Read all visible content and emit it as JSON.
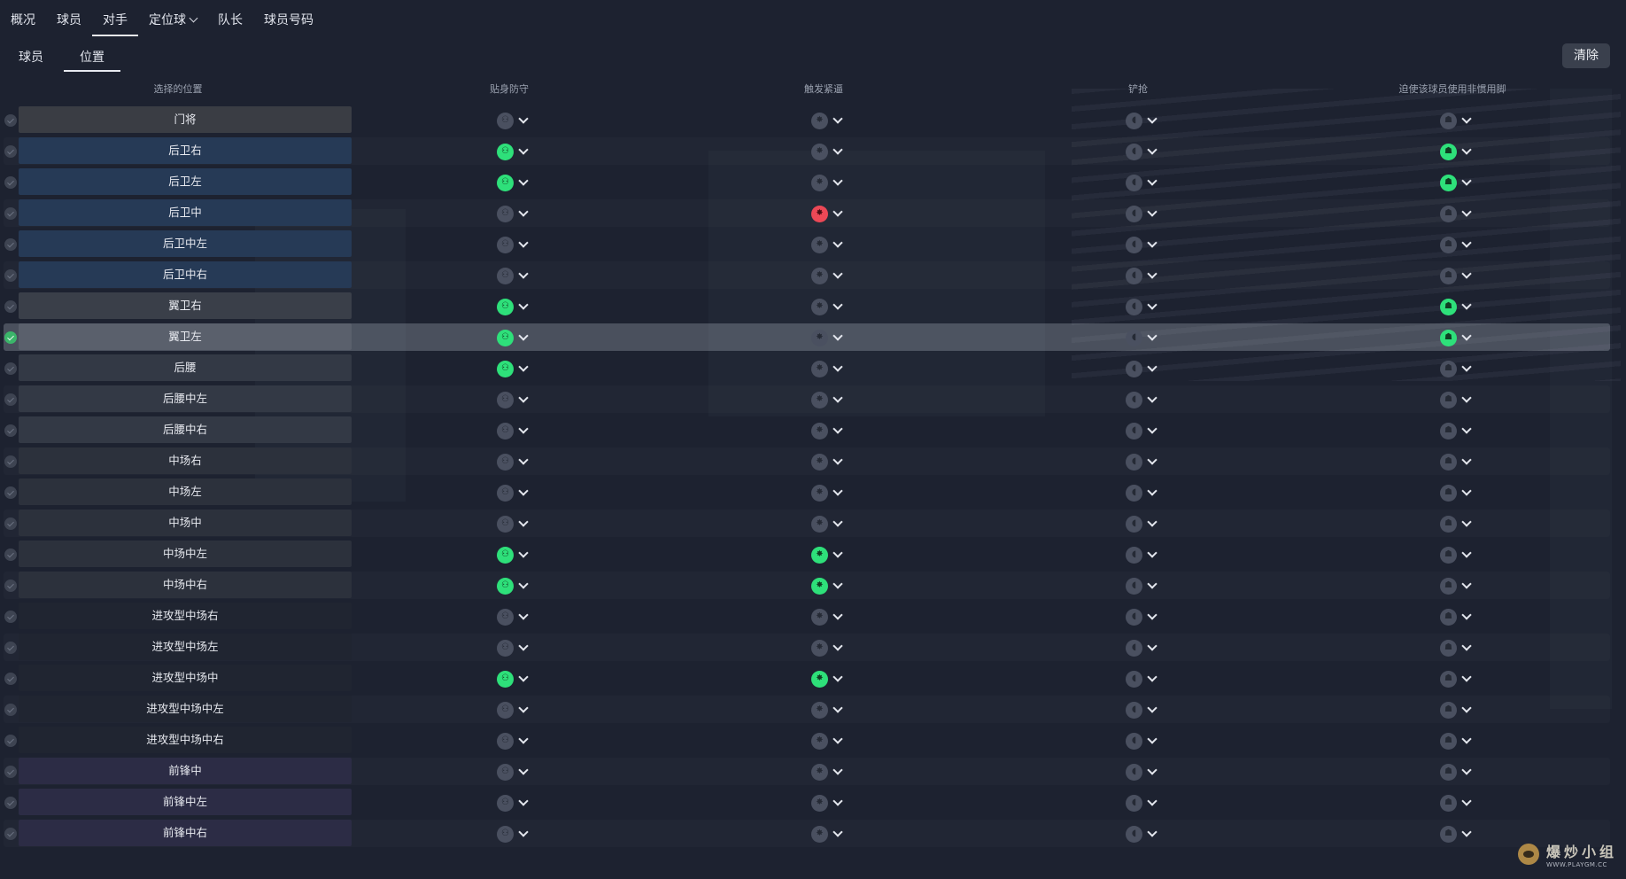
{
  "top_tabs": [
    {
      "label": "概况",
      "active": false
    },
    {
      "label": "球员",
      "active": false
    },
    {
      "label": "对手",
      "active": true
    },
    {
      "label": "定位球",
      "active": false,
      "dropdown": true
    },
    {
      "label": "队长",
      "active": false
    },
    {
      "label": "球员号码",
      "active": false
    }
  ],
  "sub_tabs": [
    {
      "label": "球员",
      "active": false
    },
    {
      "label": "位置",
      "active": true
    }
  ],
  "clear_button": "清除",
  "columns": {
    "position": "选择的位置",
    "tight_marking": "贴身防守",
    "trigger_press": "触发紧逼",
    "tackling": "铲抢",
    "weak_foot": "迫使该球员使用非惯用脚"
  },
  "icon_names": {
    "tight_marking": "tight-marking-icon",
    "trigger_press": "trigger-press-icon",
    "tackling": "tackling-icon",
    "weak_foot": "weak-foot-icon"
  },
  "states_legend": {
    "off": "not set (grey)",
    "on": "enabled (green)",
    "neg": "disabled (red)"
  },
  "colors": {
    "on": "#2ee07a",
    "neg": "#ec4856",
    "off": "#4a5060",
    "selected_check": "#3bb56a"
  },
  "rows": [
    {
      "position": "门将",
      "group": "gk",
      "marking": "off",
      "press": "off",
      "tackle": "off",
      "weakfoot": "off",
      "selected": false
    },
    {
      "position": "后卫右",
      "group": "def",
      "marking": "on",
      "press": "off",
      "tackle": "off",
      "weakfoot": "on",
      "selected": false
    },
    {
      "position": "后卫左",
      "group": "def",
      "marking": "on",
      "press": "off",
      "tackle": "off",
      "weakfoot": "on",
      "selected": false
    },
    {
      "position": "后卫中",
      "group": "def",
      "marking": "off",
      "press": "neg",
      "tackle": "off",
      "weakfoot": "off",
      "selected": false
    },
    {
      "position": "后卫中左",
      "group": "def",
      "marking": "off",
      "press": "off",
      "tackle": "off",
      "weakfoot": "off",
      "selected": false
    },
    {
      "position": "后卫中右",
      "group": "def",
      "marking": "off",
      "press": "off",
      "tackle": "off",
      "weakfoot": "off",
      "selected": false
    },
    {
      "position": "翼卫右",
      "group": "wb",
      "marking": "on",
      "press": "off",
      "tackle": "off",
      "weakfoot": "on",
      "selected": false
    },
    {
      "position": "翼卫左",
      "group": "wb",
      "marking": "on",
      "press": "off",
      "tackle": "off",
      "weakfoot": "on",
      "selected": true
    },
    {
      "position": "后腰",
      "group": "dm",
      "marking": "on",
      "press": "off",
      "tackle": "off",
      "weakfoot": "off",
      "selected": false
    },
    {
      "position": "后腰中左",
      "group": "dm",
      "marking": "off",
      "press": "off",
      "tackle": "off",
      "weakfoot": "off",
      "selected": false
    },
    {
      "position": "后腰中右",
      "group": "dm",
      "marking": "off",
      "press": "off",
      "tackle": "off",
      "weakfoot": "off",
      "selected": false
    },
    {
      "position": "中场右",
      "group": "mid",
      "marking": "off",
      "press": "off",
      "tackle": "off",
      "weakfoot": "off",
      "selected": false
    },
    {
      "position": "中场左",
      "group": "mid",
      "marking": "off",
      "press": "off",
      "tackle": "off",
      "weakfoot": "off",
      "selected": false
    },
    {
      "position": "中场中",
      "group": "mid",
      "marking": "off",
      "press": "off",
      "tackle": "off",
      "weakfoot": "off",
      "selected": false
    },
    {
      "position": "中场中左",
      "group": "mid",
      "marking": "on",
      "press": "on",
      "tackle": "off",
      "weakfoot": "off",
      "selected": false
    },
    {
      "position": "中场中右",
      "group": "mid",
      "marking": "on",
      "press": "on",
      "tackle": "off",
      "weakfoot": "off",
      "selected": false
    },
    {
      "position": "进攻型中场右",
      "group": "am",
      "marking": "off",
      "press": "off",
      "tackle": "off",
      "weakfoot": "off",
      "selected": false
    },
    {
      "position": "进攻型中场左",
      "group": "am",
      "marking": "off",
      "press": "off",
      "tackle": "off",
      "weakfoot": "off",
      "selected": false
    },
    {
      "position": "进攻型中场中",
      "group": "am",
      "marking": "on",
      "press": "on",
      "tackle": "off",
      "weakfoot": "off",
      "selected": false
    },
    {
      "position": "进攻型中场中左",
      "group": "am",
      "marking": "off",
      "press": "off",
      "tackle": "off",
      "weakfoot": "off",
      "selected": false
    },
    {
      "position": "进攻型中场中右",
      "group": "am",
      "marking": "off",
      "press": "off",
      "tackle": "off",
      "weakfoot": "off",
      "selected": false
    },
    {
      "position": "前锋中",
      "group": "st",
      "marking": "off",
      "press": "off",
      "tackle": "off",
      "weakfoot": "off",
      "selected": false
    },
    {
      "position": "前锋中左",
      "group": "st",
      "marking": "off",
      "press": "off",
      "tackle": "off",
      "weakfoot": "off",
      "selected": false
    },
    {
      "position": "前锋中右",
      "group": "st",
      "marking": "off",
      "press": "off",
      "tackle": "off",
      "weakfoot": "off",
      "selected": false
    }
  ],
  "watermark": {
    "title": "爆炒小组",
    "url": "WWW.PLAYGM.CC"
  }
}
